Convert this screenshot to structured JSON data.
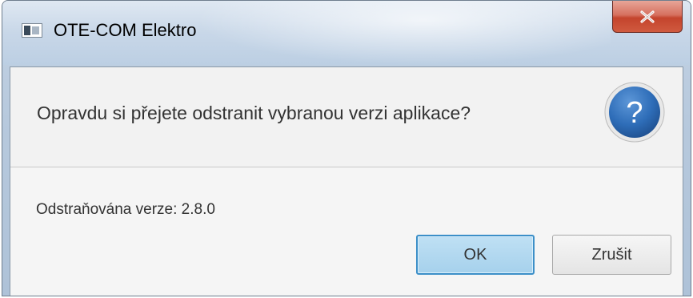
{
  "window": {
    "title": "OTE-COM Elektro",
    "close_icon": "close-icon"
  },
  "dialog": {
    "question": "Opravdu si přejete odstranit vybranou verzi aplikace?",
    "question_icon": "question-mark-icon",
    "question_icon_glyph": "?",
    "detail": "Odstraňována verze: 2.8.0"
  },
  "buttons": {
    "ok_label": "OK",
    "cancel_label": "Zrušit"
  },
  "colors": {
    "accent_button_border": "#3c8fc8",
    "accent_button_fill": "#a6d1ec",
    "close_button": "#c4442d",
    "question_icon": "#2e6db8"
  }
}
